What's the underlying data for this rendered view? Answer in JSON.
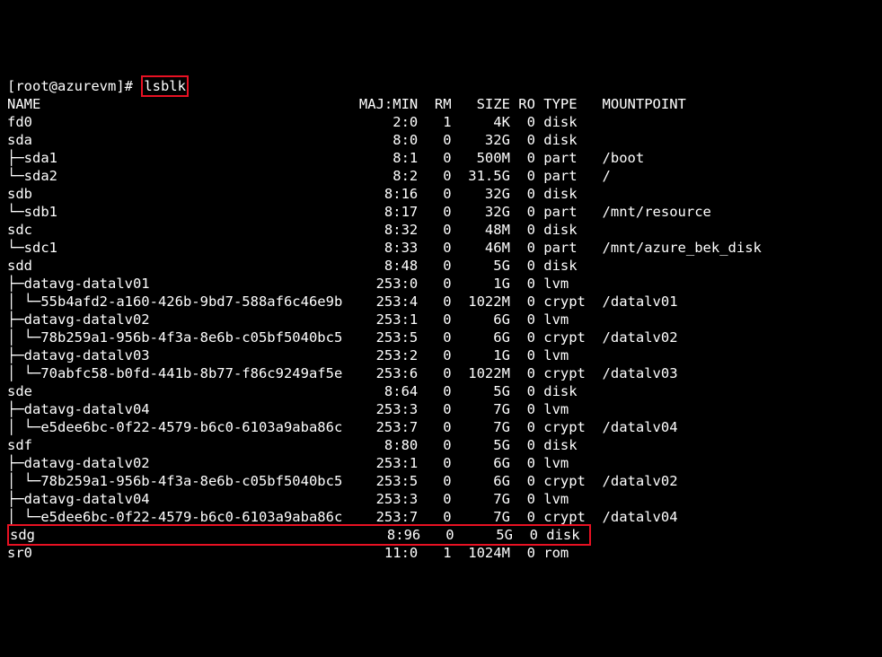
{
  "prompt": {
    "user": "root",
    "host": "azurevm",
    "symbol": "#",
    "cmd": "lsblk"
  },
  "header": {
    "name": "NAME",
    "majmin": "MAJ:MIN",
    "rm": "RM",
    "size": "SIZE",
    "ro": "RO",
    "type": "TYPE",
    "mount": "MOUNTPOINT"
  },
  "rows": [
    {
      "tree": "fd0",
      "majmin": "2:0",
      "rm": "1",
      "size": "4K",
      "ro": "0",
      "type": "disk",
      "mount": ""
    },
    {
      "tree": "sda",
      "majmin": "8:0",
      "rm": "0",
      "size": "32G",
      "ro": "0",
      "type": "disk",
      "mount": ""
    },
    {
      "tree": "├─sda1",
      "majmin": "8:1",
      "rm": "0",
      "size": "500M",
      "ro": "0",
      "type": "part",
      "mount": "/boot"
    },
    {
      "tree": "└─sda2",
      "majmin": "8:2",
      "rm": "0",
      "size": "31.5G",
      "ro": "0",
      "type": "part",
      "mount": "/"
    },
    {
      "tree": "sdb",
      "majmin": "8:16",
      "rm": "0",
      "size": "32G",
      "ro": "0",
      "type": "disk",
      "mount": ""
    },
    {
      "tree": "└─sdb1",
      "majmin": "8:17",
      "rm": "0",
      "size": "32G",
      "ro": "0",
      "type": "part",
      "mount": "/mnt/resource"
    },
    {
      "tree": "sdc",
      "majmin": "8:32",
      "rm": "0",
      "size": "48M",
      "ro": "0",
      "type": "disk",
      "mount": ""
    },
    {
      "tree": "└─sdc1",
      "majmin": "8:33",
      "rm": "0",
      "size": "46M",
      "ro": "0",
      "type": "part",
      "mount": "/mnt/azure_bek_disk"
    },
    {
      "tree": "sdd",
      "majmin": "8:48",
      "rm": "0",
      "size": "5G",
      "ro": "0",
      "type": "disk",
      "mount": ""
    },
    {
      "tree": "├─datavg-datalv01",
      "majmin": "253:0",
      "rm": "0",
      "size": "1G",
      "ro": "0",
      "type": "lvm",
      "mount": ""
    },
    {
      "tree": "│ └─55b4afd2-a160-426b-9bd7-588af6c46e9b",
      "majmin": "253:4",
      "rm": "0",
      "size": "1022M",
      "ro": "0",
      "type": "crypt",
      "mount": "/datalv01"
    },
    {
      "tree": "├─datavg-datalv02",
      "majmin": "253:1",
      "rm": "0",
      "size": "6G",
      "ro": "0",
      "type": "lvm",
      "mount": ""
    },
    {
      "tree": "│ └─78b259a1-956b-4f3a-8e6b-c05bf5040bc5",
      "majmin": "253:5",
      "rm": "0",
      "size": "6G",
      "ro": "0",
      "type": "crypt",
      "mount": "/datalv02"
    },
    {
      "tree": "├─datavg-datalv03",
      "majmin": "253:2",
      "rm": "0",
      "size": "1G",
      "ro": "0",
      "type": "lvm",
      "mount": ""
    },
    {
      "tree": "│ └─70abfc58-b0fd-441b-8b77-f86c9249af5e",
      "majmin": "253:6",
      "rm": "0",
      "size": "1022M",
      "ro": "0",
      "type": "crypt",
      "mount": "/datalv03"
    },
    {
      "tree": "sde",
      "majmin": "8:64",
      "rm": "0",
      "size": "5G",
      "ro": "0",
      "type": "disk",
      "mount": ""
    },
    {
      "tree": "├─datavg-datalv04",
      "majmin": "253:3",
      "rm": "0",
      "size": "7G",
      "ro": "0",
      "type": "lvm",
      "mount": ""
    },
    {
      "tree": "│ └─e5dee6bc-0f22-4579-b6c0-6103a9aba86c",
      "majmin": "253:7",
      "rm": "0",
      "size": "7G",
      "ro": "0",
      "type": "crypt",
      "mount": "/datalv04"
    },
    {
      "tree": "sdf",
      "majmin": "8:80",
      "rm": "0",
      "size": "5G",
      "ro": "0",
      "type": "disk",
      "mount": ""
    },
    {
      "tree": "├─datavg-datalv02",
      "majmin": "253:1",
      "rm": "0",
      "size": "6G",
      "ro": "0",
      "type": "lvm",
      "mount": ""
    },
    {
      "tree": "│ └─78b259a1-956b-4f3a-8e6b-c05bf5040bc5",
      "majmin": "253:5",
      "rm": "0",
      "size": "6G",
      "ro": "0",
      "type": "crypt",
      "mount": "/datalv02"
    },
    {
      "tree": "├─datavg-datalv04",
      "majmin": "253:3",
      "rm": "0",
      "size": "7G",
      "ro": "0",
      "type": "lvm",
      "mount": ""
    },
    {
      "tree": "│ └─e5dee6bc-0f22-4579-b6c0-6103a9aba86c",
      "majmin": "253:7",
      "rm": "0",
      "size": "7G",
      "ro": "0",
      "type": "crypt",
      "mount": "/datalv04"
    },
    {
      "tree": "sdg",
      "majmin": "8:96",
      "rm": "0",
      "size": "5G",
      "ro": "0",
      "type": "disk",
      "mount": "",
      "highlightRow": true
    },
    {
      "tree": "sr0",
      "majmin": "11:0",
      "rm": "1",
      "size": "1024M",
      "ro": "0",
      "type": "rom",
      "mount": ""
    }
  ],
  "highlights": [
    "cmd",
    "row:sdg"
  ]
}
